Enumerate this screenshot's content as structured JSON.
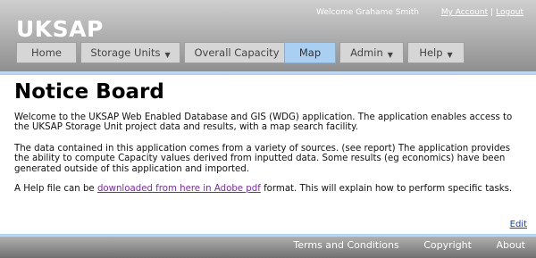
{
  "site": {
    "logo": "UKSAP"
  },
  "top_links": {
    "welcome": "Welcome Grahame Smith",
    "my_account": "My Account",
    "separator": "|",
    "logout": "Logout"
  },
  "nav": {
    "tabs": [
      {
        "label": "Home",
        "has_dropdown": false,
        "active": false
      },
      {
        "label": "Storage Units",
        "has_dropdown": true,
        "active": false
      },
      {
        "label": "Overall Capacity",
        "has_dropdown": false,
        "active": false
      },
      {
        "label": "Map",
        "has_dropdown": false,
        "active": true
      },
      {
        "label": "Admin",
        "has_dropdown": true,
        "active": false
      },
      {
        "label": "Help",
        "has_dropdown": true,
        "active": false
      }
    ],
    "dropdown_glyph": "▼"
  },
  "content": {
    "title": "Notice Board",
    "paragraph1": "Welcome to the UKSAP Web Enabled Database and GIS (WDG) application. The application enables access to the UKSAP Storage Unit project data and results, with a map search facility.",
    "paragraph2": "The data contained in this application comes from a variety of sources. (see report) The application provides the ability to compute Capacity values derived from inputted data. Some results (eg economics) have been generated outside of this application and imported.",
    "paragraph3_before": "A Help file can be ",
    "paragraph3_link": "downloaded from here in Adobe pdf",
    "paragraph3_after": " format. This will explain how to perform specific tasks.",
    "edit_link": "Edit"
  },
  "footer": {
    "links": [
      "Terms and Conditions",
      "Copyright",
      "About"
    ]
  },
  "colors": {
    "header_top": "#cfcfcf",
    "header_bottom": "#8f8f8f",
    "accent_blue": "#a9cff2",
    "link_visited": "#7a2b9c",
    "link": "#1a3fb0"
  }
}
